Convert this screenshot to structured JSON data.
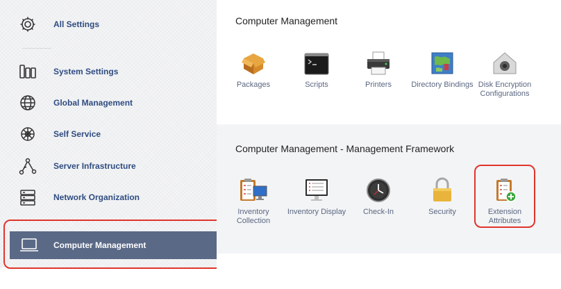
{
  "sidebar": {
    "items": [
      {
        "label": "All Settings",
        "icon": "gear-icon"
      },
      {
        "label": "System Settings",
        "icon": "columns-icon"
      },
      {
        "label": "Global Management",
        "icon": "globe-icon"
      },
      {
        "label": "Self Service",
        "icon": "self-service-icon"
      },
      {
        "label": "Server Infrastructure",
        "icon": "network-nodes-icon"
      },
      {
        "label": "Network Organization",
        "icon": "server-rack-icon"
      }
    ],
    "active": {
      "label": "Computer Management",
      "icon": "laptop-icon"
    }
  },
  "main": {
    "section1": {
      "title": "Computer Management",
      "tiles": [
        {
          "label": "Packages",
          "icon": "package-box-icon"
        },
        {
          "label": "Scripts",
          "icon": "terminal-icon"
        },
        {
          "label": "Printers",
          "icon": "printer-icon"
        },
        {
          "label": "Directory Bindings",
          "icon": "map-icon"
        },
        {
          "label": "Disk Encryption Configurations",
          "icon": "house-vault-icon"
        }
      ]
    },
    "section2": {
      "title": "Computer Management - Management Framework",
      "tiles": [
        {
          "label": "Inventory Collection",
          "icon": "clipboard-monitor-icon"
        },
        {
          "label": "Inventory Display",
          "icon": "display-list-icon"
        },
        {
          "label": "Check-In",
          "icon": "clock-icon"
        },
        {
          "label": "Security",
          "icon": "padlock-icon"
        },
        {
          "label": "Extension Attributes",
          "icon": "clipboard-plus-icon"
        }
      ]
    }
  },
  "colors": {
    "accent_red": "#e0342b",
    "active_bg": "#5a6986",
    "label_blue": "#2f4c80"
  }
}
